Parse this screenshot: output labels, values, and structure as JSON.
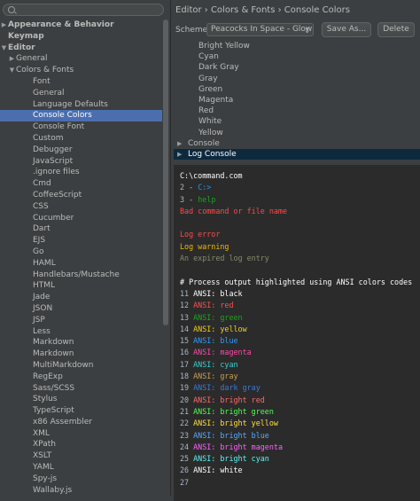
{
  "sidebar": {
    "search_placeholder": "",
    "tree": [
      {
        "label": "Appearance & Behavior",
        "indent": 0,
        "arrow": "collapsed"
      },
      {
        "label": "Keymap",
        "indent": 0,
        "arrow": "none"
      },
      {
        "label": "Editor",
        "indent": 0,
        "arrow": "expanded"
      },
      {
        "label": "General",
        "indent": 1,
        "arrow": "collapsed"
      },
      {
        "label": "Colors & Fonts",
        "indent": 1,
        "arrow": "expanded"
      },
      {
        "label": "Font",
        "indent": 2,
        "arrow": "none"
      },
      {
        "label": "General",
        "indent": 2,
        "arrow": "none"
      },
      {
        "label": "Language Defaults",
        "indent": 2,
        "arrow": "none"
      },
      {
        "label": "Console Colors",
        "indent": 2,
        "arrow": "none",
        "selected": true
      },
      {
        "label": "Console Font",
        "indent": 2,
        "arrow": "none"
      },
      {
        "label": "Custom",
        "indent": 2,
        "arrow": "none"
      },
      {
        "label": "Debugger",
        "indent": 2,
        "arrow": "none"
      },
      {
        "label": "JavaScript",
        "indent": 2,
        "arrow": "none"
      },
      {
        "label": ".ignore files",
        "indent": 2,
        "arrow": "none"
      },
      {
        "label": "Cmd",
        "indent": 2,
        "arrow": "none"
      },
      {
        "label": "CoffeeScript",
        "indent": 2,
        "arrow": "none"
      },
      {
        "label": "CSS",
        "indent": 2,
        "arrow": "none"
      },
      {
        "label": "Cucumber",
        "indent": 2,
        "arrow": "none"
      },
      {
        "label": "Dart",
        "indent": 2,
        "arrow": "none"
      },
      {
        "label": "EJS",
        "indent": 2,
        "arrow": "none"
      },
      {
        "label": "Go",
        "indent": 2,
        "arrow": "none"
      },
      {
        "label": "HAML",
        "indent": 2,
        "arrow": "none"
      },
      {
        "label": "Handlebars/Mustache",
        "indent": 2,
        "arrow": "none"
      },
      {
        "label": "HTML",
        "indent": 2,
        "arrow": "none"
      },
      {
        "label": "Jade",
        "indent": 2,
        "arrow": "none"
      },
      {
        "label": "JSON",
        "indent": 2,
        "arrow": "none"
      },
      {
        "label": "JSP",
        "indent": 2,
        "arrow": "none"
      },
      {
        "label": "Less",
        "indent": 2,
        "arrow": "none"
      },
      {
        "label": "Markdown",
        "indent": 2,
        "arrow": "none"
      },
      {
        "label": "Markdown",
        "indent": 2,
        "arrow": "none"
      },
      {
        "label": "MultiMarkdown",
        "indent": 2,
        "arrow": "none"
      },
      {
        "label": "RegExp",
        "indent": 2,
        "arrow": "none"
      },
      {
        "label": "Sass/SCSS",
        "indent": 2,
        "arrow": "none"
      },
      {
        "label": "Stylus",
        "indent": 2,
        "arrow": "none"
      },
      {
        "label": "TypeScript",
        "indent": 2,
        "arrow": "none"
      },
      {
        "label": "x86 Assembler",
        "indent": 2,
        "arrow": "none"
      },
      {
        "label": "XML",
        "indent": 2,
        "arrow": "none"
      },
      {
        "label": "XPath",
        "indent": 2,
        "arrow": "none"
      },
      {
        "label": "XSLT",
        "indent": 2,
        "arrow": "none"
      },
      {
        "label": "YAML",
        "indent": 2,
        "arrow": "none"
      },
      {
        "label": "Spy-js",
        "indent": 2,
        "arrow": "none"
      },
      {
        "label": "Wallaby.js",
        "indent": 2,
        "arrow": "none"
      }
    ]
  },
  "header": {
    "breadcrumb": "Editor › Colors & Fonts › Console Colors",
    "scheme_label": "Scheme:",
    "scheme_value": "Peacocks In Space - Glow",
    "save_as_label": "Save As...",
    "delete_label": "Delete"
  },
  "elements": [
    {
      "label": "Bright Yellow",
      "type": "child"
    },
    {
      "label": "Cyan",
      "type": "child"
    },
    {
      "label": "Dark Gray",
      "type": "child"
    },
    {
      "label": "Gray",
      "type": "child"
    },
    {
      "label": "Green",
      "type": "child"
    },
    {
      "label": "Magenta",
      "type": "child"
    },
    {
      "label": "Red",
      "type": "child"
    },
    {
      "label": "White",
      "type": "child"
    },
    {
      "label": "Yellow",
      "type": "child"
    },
    {
      "label": "Console",
      "type": "group"
    },
    {
      "label": "Log Console",
      "type": "group",
      "selected": true
    }
  ],
  "colors": {
    "selection": "#4b6eaf",
    "list_selection": "#0d293e",
    "preview_bg": "#2b2b2b",
    "line_number": "#a9b7c6"
  },
  "preview": [
    {
      "num": "",
      "segments": [
        {
          "text": "C:\\command.com",
          "color": "#ffffff"
        }
      ]
    },
    {
      "num": "2",
      "segments": [
        {
          "text": " - ",
          "color": "#bbbbbb"
        },
        {
          "text": "C:>",
          "color": "#2196f3"
        }
      ]
    },
    {
      "num": "3",
      "segments": [
        {
          "text": " - ",
          "color": "#bbbbbb"
        },
        {
          "text": "help",
          "color": "#20a020"
        }
      ]
    },
    {
      "num": "",
      "segments": [
        {
          "text": "Bad command or file name",
          "color": "#ff4a4a"
        }
      ]
    },
    {
      "num": "",
      "segments": [
        {
          "text": "",
          "color": "#bbbbbb"
        }
      ]
    },
    {
      "num": "",
      "segments": [
        {
          "text": "Log error",
          "color": "#ff4a4a"
        }
      ]
    },
    {
      "num": "",
      "segments": [
        {
          "text": "Log warning",
          "color": "#f0b800"
        }
      ]
    },
    {
      "num": "",
      "segments": [
        {
          "text": "An expired log entry",
          "color": "#8a8a6a"
        }
      ]
    },
    {
      "num": "",
      "segments": [
        {
          "text": "",
          "color": "#bbbbbb"
        }
      ]
    },
    {
      "num": "",
      "segments": [
        {
          "text": "# Process output highlighted using ANSI colors codes",
          "color": "#ffffff"
        }
      ]
    },
    {
      "num": "11",
      "segments": [
        {
          "text": " ANSI: ",
          "color": "#ffffff"
        },
        {
          "text": "black",
          "color": "#ffffff"
        }
      ]
    },
    {
      "num": "12",
      "segments": [
        {
          "text": " ANSI: ",
          "color": "#ff5050"
        },
        {
          "text": "red",
          "color": "#ff5050"
        }
      ]
    },
    {
      "num": "13",
      "segments": [
        {
          "text": " ANSI: ",
          "color": "#18a818"
        },
        {
          "text": "green",
          "color": "#18a818"
        }
      ]
    },
    {
      "num": "14",
      "segments": [
        {
          "text": " ANSI: ",
          "color": "#f0d020"
        },
        {
          "text": "yellow",
          "color": "#f0d020"
        }
      ]
    },
    {
      "num": "15",
      "segments": [
        {
          "text": " ANSI: ",
          "color": "#2f9cff"
        },
        {
          "text": "blue",
          "color": "#2f9cff"
        }
      ]
    },
    {
      "num": "16",
      "segments": [
        {
          "text": " ANSI: ",
          "color": "#ff4aa8"
        },
        {
          "text": "magenta",
          "color": "#ff4aa8"
        }
      ]
    },
    {
      "num": "17",
      "segments": [
        {
          "text": " ANSI: ",
          "color": "#3ad0d0"
        },
        {
          "text": "cyan",
          "color": "#3ad0d0"
        }
      ]
    },
    {
      "num": "18",
      "segments": [
        {
          "text": " ANSI: ",
          "color": "#c8a050"
        },
        {
          "text": "gray",
          "color": "#c8a050"
        }
      ]
    },
    {
      "num": "19",
      "segments": [
        {
          "text": " ANSI: ",
          "color": "#3c78d8"
        },
        {
          "text": "dark gray",
          "color": "#3c78d8"
        }
      ]
    },
    {
      "num": "20",
      "segments": [
        {
          "text": " ANSI: ",
          "color": "#ff6a6a"
        },
        {
          "text": "bright red",
          "color": "#ff6a6a"
        }
      ]
    },
    {
      "num": "21",
      "segments": [
        {
          "text": " ANSI: ",
          "color": "#50ff50"
        },
        {
          "text": "bright green",
          "color": "#50ff50"
        }
      ]
    },
    {
      "num": "22",
      "segments": [
        {
          "text": " ANSI: ",
          "color": "#ffe040"
        },
        {
          "text": "bright yellow",
          "color": "#ffe040"
        }
      ]
    },
    {
      "num": "23",
      "segments": [
        {
          "text": " ANSI: ",
          "color": "#58a8ff"
        },
        {
          "text": "bright blue",
          "color": "#58a8ff"
        }
      ]
    },
    {
      "num": "24",
      "segments": [
        {
          "text": " ANSI: ",
          "color": "#ff60ff"
        },
        {
          "text": "bright magenta",
          "color": "#ff60ff"
        }
      ]
    },
    {
      "num": "25",
      "segments": [
        {
          "text": " ANSI: ",
          "color": "#60f0f0"
        },
        {
          "text": "bright cyan",
          "color": "#60f0f0"
        }
      ]
    },
    {
      "num": "26",
      "segments": [
        {
          "text": " ANSI: ",
          "color": "#ffffff"
        },
        {
          "text": "white",
          "color": "#ffffff"
        }
      ]
    },
    {
      "num": "27",
      "segments": [
        {
          "text": "",
          "color": "#bbbbbb"
        }
      ]
    }
  ]
}
